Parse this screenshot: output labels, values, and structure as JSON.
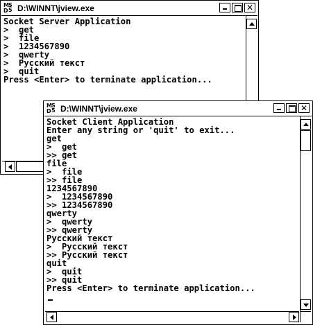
{
  "server": {
    "title": "D:\\WINNT\\jview.exe",
    "lines": [
      "Socket Server Application",
      ">  get",
      ">  file",
      ">  1234567890",
      ">  qwerty",
      ">  Русский текст",
      ">  quit",
      "Press <Enter> to terminate application..."
    ]
  },
  "client": {
    "title": "D:\\WINNT\\jview.exe",
    "lines": [
      "Socket Client Application",
      "Enter any string or 'quit' to exit...",
      "get",
      ">  get",
      ">> get",
      "file",
      ">  file",
      ">> file",
      "1234567890",
      ">  1234567890",
      ">> 1234567890",
      "qwerty",
      ">  qwerty",
      ">> qwerty",
      "Русский текст",
      ">  Русский текст",
      ">> Русский текст",
      "quit",
      ">  quit",
      ">> quit",
      "Press <Enter> to terminate application..."
    ]
  },
  "window_buttons": {
    "close": "✕"
  },
  "icons": {
    "app_icon": "ms-dos-icon",
    "minimize": "minimize-icon",
    "maximize": "maximize-icon",
    "close": "close-icon"
  }
}
